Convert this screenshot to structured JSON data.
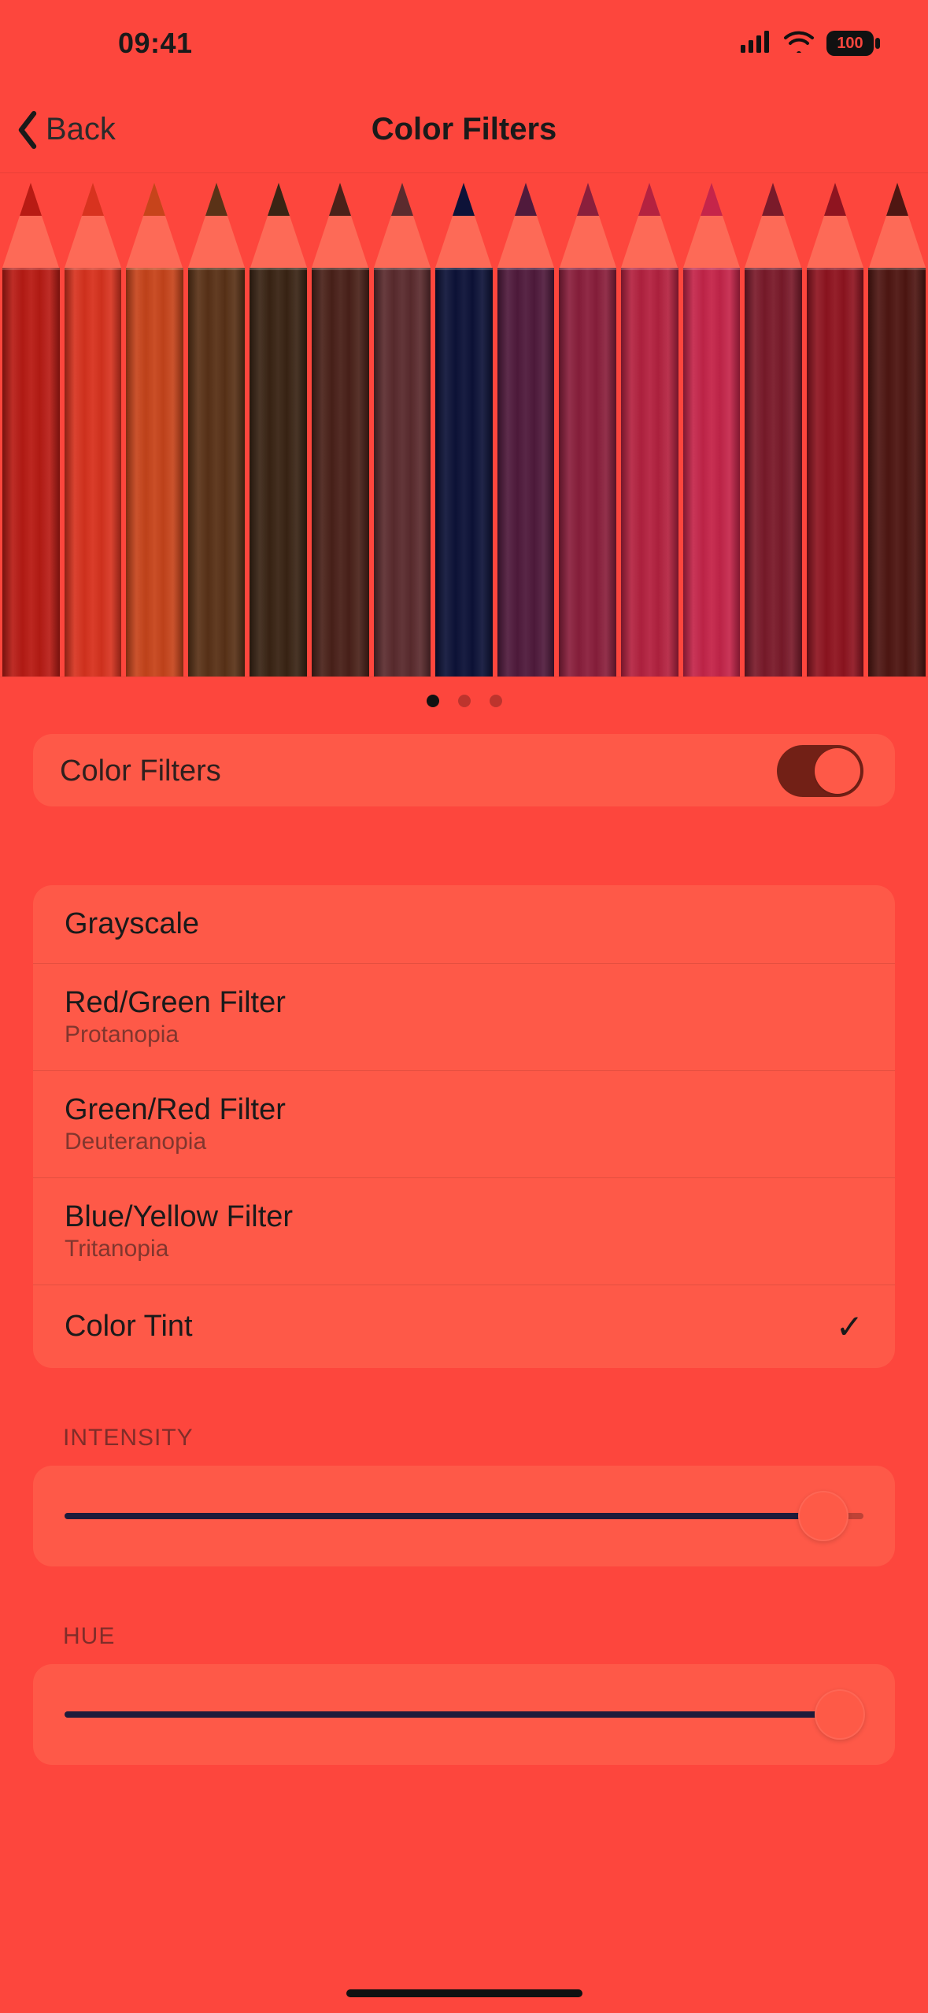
{
  "status": {
    "time": "09:41",
    "battery": "100"
  },
  "nav": {
    "back": "Back",
    "title": "Color Filters"
  },
  "toggle": {
    "label": "Color Filters",
    "on": true
  },
  "filters": [
    {
      "label": "Grayscale",
      "sub": null,
      "selected": false
    },
    {
      "label": "Red/Green Filter",
      "sub": "Protanopia",
      "selected": false
    },
    {
      "label": "Green/Red Filter",
      "sub": "Deuteranopia",
      "selected": false
    },
    {
      "label": "Blue/Yellow Filter",
      "sub": "Tritanopia",
      "selected": false
    },
    {
      "label": "Color Tint",
      "sub": null,
      "selected": true
    }
  ],
  "sections": {
    "intensity": "INTENSITY",
    "hue": "HUE"
  },
  "sliders": {
    "intensity": 0.95,
    "hue": 0.97
  },
  "pencil_colors": [
    "#b81b14",
    "#d8331f",
    "#c7441b",
    "#5a3217",
    "#3a2414",
    "#4a2119",
    "#5b2b2e",
    "#0d1238",
    "#501a3c",
    "#8a1f3c",
    "#b42240",
    "#c5254a",
    "#7a1a2a",
    "#8f1420",
    "#4f1612"
  ],
  "page_indicator": {
    "count": 3,
    "active": 0
  }
}
